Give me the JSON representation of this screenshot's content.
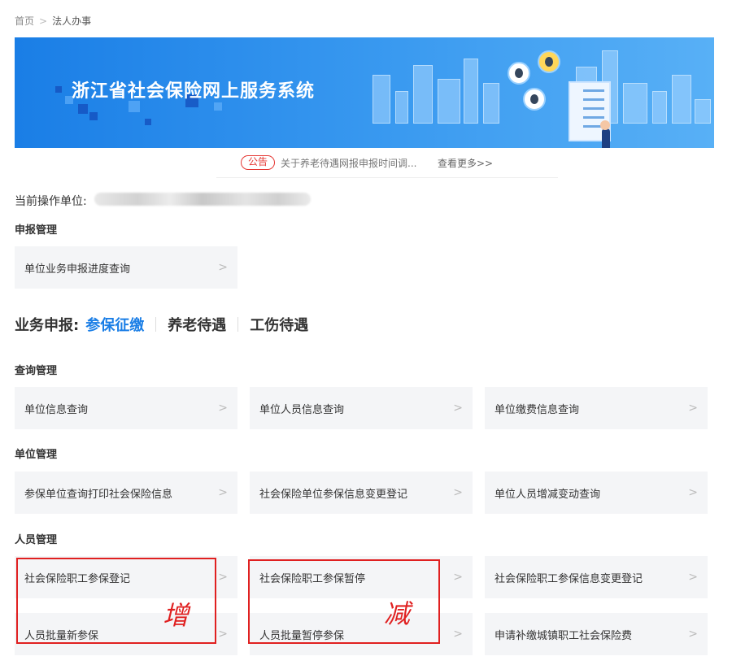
{
  "breadcrumb": {
    "home": "首页",
    "separator": ">",
    "current": "法人办事"
  },
  "banner": {
    "title": "浙江省社会保险网上服务系统"
  },
  "notice": {
    "tag": "公告",
    "text": "关于养老待遇网报申报时间调...",
    "more": "查看更多>>"
  },
  "unit": {
    "label": "当前操作单位:"
  },
  "declare": {
    "heading": "申报管理",
    "items": [
      "单位业务申报进度查询"
    ]
  },
  "business": {
    "lead": "业务申报:",
    "tabs": [
      "参保征缴",
      "养老待遇",
      "工伤待遇"
    ],
    "active_color": "#1a7ee6"
  },
  "query": {
    "heading": "查询管理",
    "items": [
      "单位信息查询",
      "单位人员信息查询",
      "单位缴费信息查询"
    ]
  },
  "unit_mgmt": {
    "heading": "单位管理",
    "items": [
      "参保单位查询打印社会保险信息",
      "社会保险单位参保信息变更登记",
      "单位人员增减变动查询"
    ]
  },
  "person_mgmt": {
    "heading": "人员管理",
    "items": [
      "社会保险职工参保登记",
      "社会保险职工参保暂停",
      "社会保险职工参保信息变更登记",
      "人员批量新参保",
      "人员批量暂停参保",
      "申请补缴城镇职工社会保险费"
    ]
  },
  "annotations": {
    "add": "增",
    "reduce": "减",
    "color": "#e02020"
  },
  "chevron": ">"
}
